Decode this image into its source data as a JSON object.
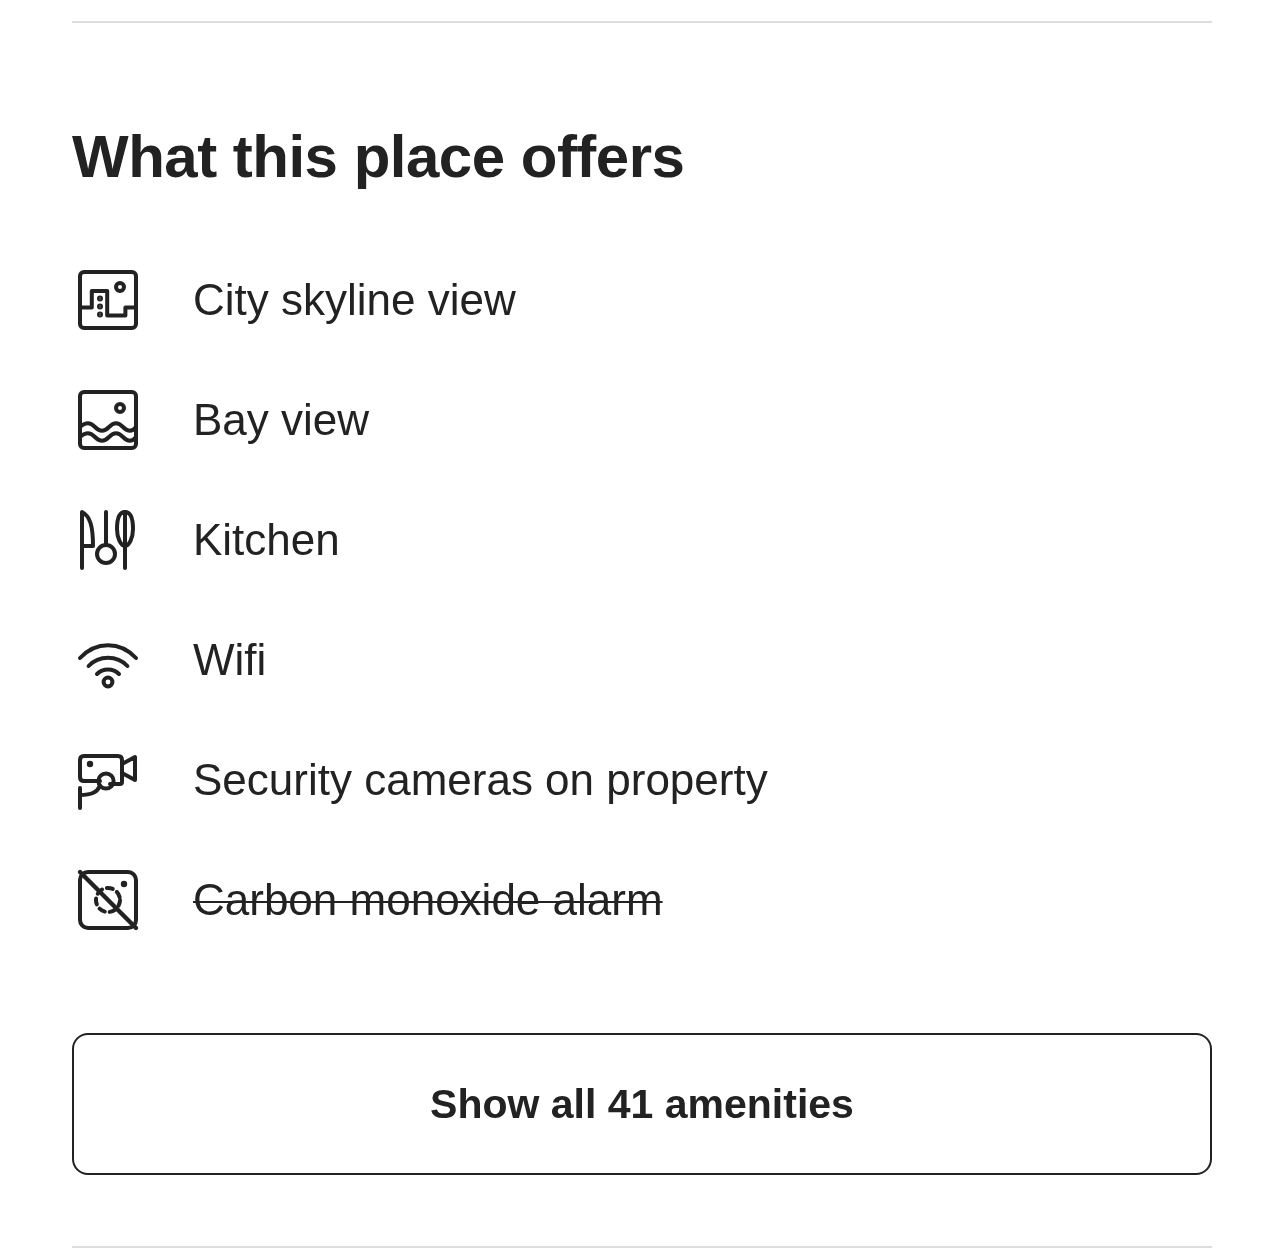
{
  "heading": "What this place offers",
  "amenities": [
    {
      "label": "City skyline view",
      "kind": "skyline",
      "available": true
    },
    {
      "label": "Bay view",
      "kind": "bay",
      "available": true
    },
    {
      "label": "Kitchen",
      "kind": "kitchen",
      "available": true
    },
    {
      "label": "Wifi",
      "kind": "wifi",
      "available": true
    },
    {
      "label": "Security cameras on property",
      "kind": "camera",
      "available": true
    },
    {
      "label": "Carbon monoxide alarm",
      "kind": "co-alarm",
      "available": false
    }
  ],
  "button": {
    "label": "Show all 41 amenities"
  }
}
